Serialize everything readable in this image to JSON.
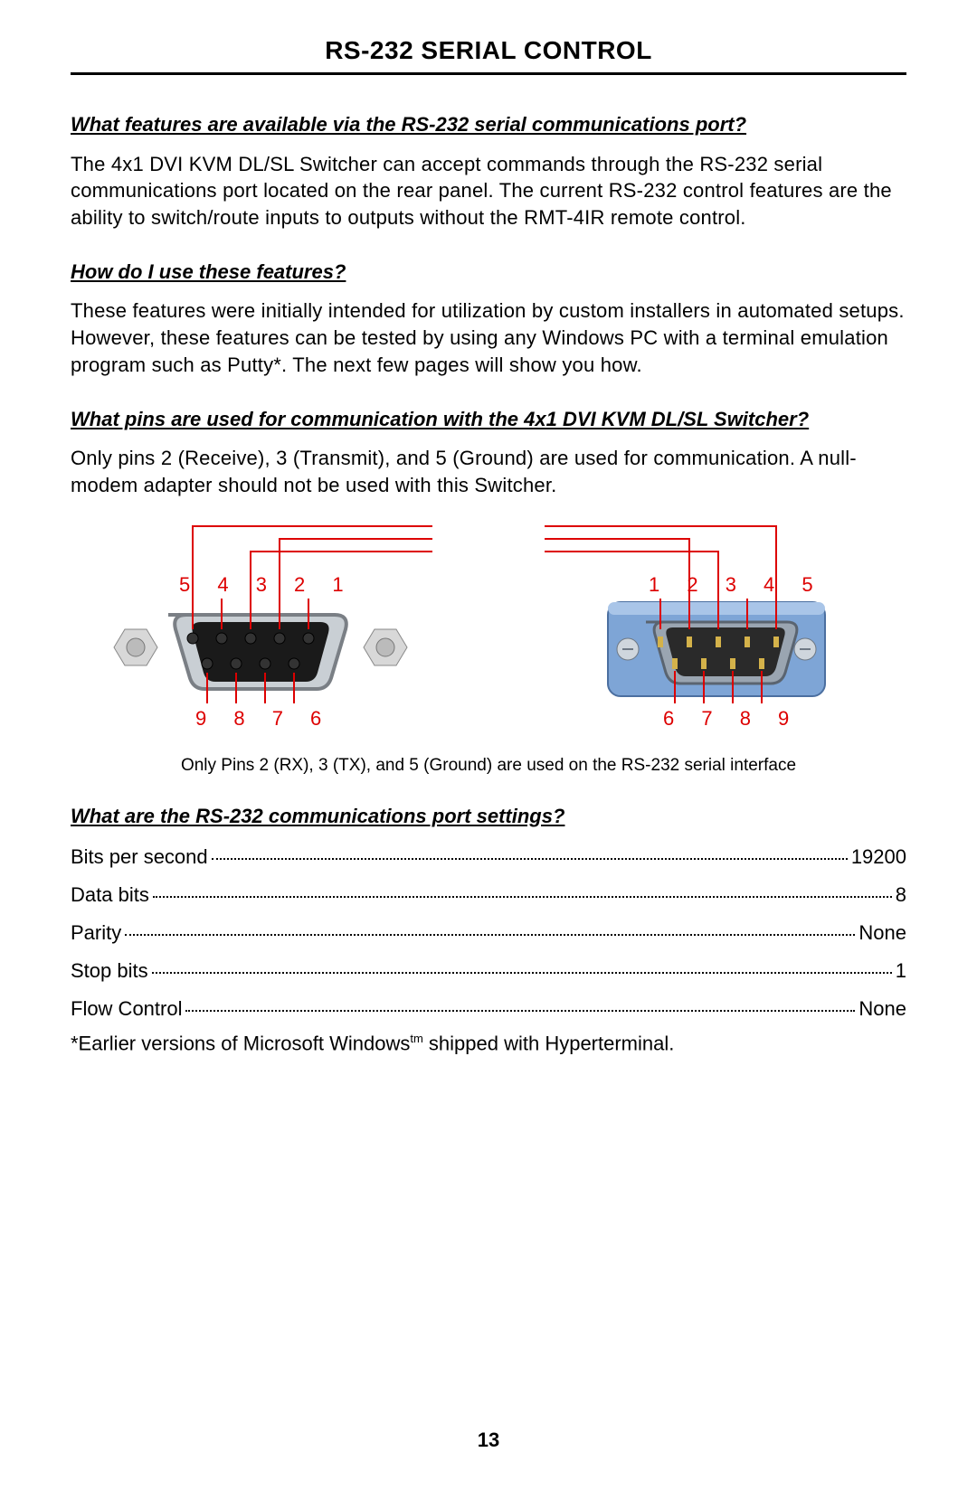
{
  "title": "RS-232 SERIAL CONTROL",
  "q1": "What features are available via the RS-232 serial communications port?",
  "a1": "The 4x1 DVI KVM DL/SL Switcher can accept commands through the RS-232 serial communications port located on the rear panel. The current RS-232 control features are the ability to switch/route inputs to outputs without the RMT-4IR remote control.",
  "q2": "How do I use these features?",
  "a2": "These features were initially intended for utilization by custom installers in automated setups. However, these features can be tested by using any Windows PC with a terminal emulation program such as Putty*. The next few pages will show you how.",
  "q3": "What pins are used for communication with the 4x1 DVI KVM DL/SL Switcher?",
  "a3": "Only pins 2 (Receive), 3 (Transmit), and 5 (Ground) are used for communication. A null-modem adapter should not be used with this Switcher.",
  "diagram": {
    "left_top": "5 4 3 2 1",
    "left_bottom": "9 8 7 6",
    "right_top": "1 2 3 4 5",
    "right_bottom": "6 7 8 9",
    "caption": "Only Pins 2 (RX), 3 (TX), and 5 (Ground) are used on the RS-232 serial interface"
  },
  "q4": "What are the RS-232 communications port settings?",
  "settings": [
    {
      "label": "Bits per second",
      "value": "19200"
    },
    {
      "label": "Data bits",
      "value": "8"
    },
    {
      "label": "Parity",
      "value": "None"
    },
    {
      "label": "Stop bits",
      "value": "1"
    },
    {
      "label": "Flow Control",
      "value": "None"
    }
  ],
  "footnote_pre": "*Earlier versions of Microsoft Windows",
  "footnote_sup": "tm",
  "footnote_post": " shipped with Hyperterminal.",
  "page_number": "13"
}
